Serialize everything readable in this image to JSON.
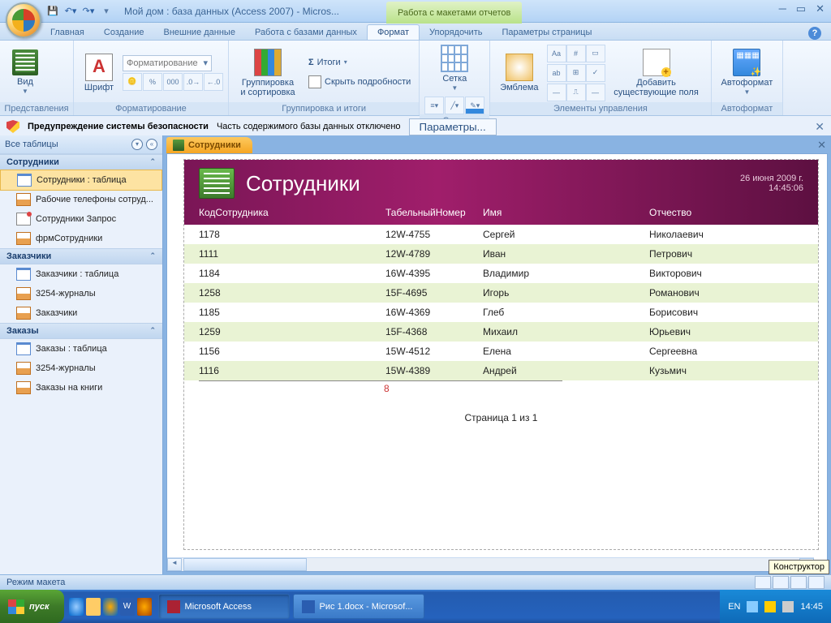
{
  "title": "Мой дом : база данных (Access 2007) - Micros...",
  "context_tab": "Работа с макетами отчетов",
  "ribbon_tabs": [
    "Главная",
    "Создание",
    "Внешние данные",
    "Работа с базами данных",
    "Формат",
    "Упорядочить",
    "Параметры страницы"
  ],
  "active_tab_index": 4,
  "ribbon": {
    "view": "Вид",
    "view_group": "Представления",
    "font": "Шрифт",
    "formatting_combo": "Форматирование",
    "formatting_group": "Форматирование",
    "grouping": "Группировка и сортировка",
    "totals": "Итоги",
    "hide_details": "Скрыть подробности",
    "grouping_group": "Группировка и итоги",
    "grid": "Сетка",
    "grid_group": "Сетка",
    "emblem": "Эмблема",
    "add_fields": "Добавить существующие поля",
    "controls_group": "Элементы управления",
    "autoformat": "Автоформат",
    "autoformat_group": "Автоформат"
  },
  "security": {
    "heading": "Предупреждение системы безопасности",
    "msg": "Часть содержимого базы данных отключено",
    "btn": "Параметры..."
  },
  "nav": {
    "header": "Все таблицы",
    "groups": [
      {
        "title": "Сотрудники",
        "items": [
          {
            "icon": "tbl",
            "label": "Сотрудники : таблица",
            "sel": true
          },
          {
            "icon": "frm",
            "label": "Рабочие телефоны сотруд..."
          },
          {
            "icon": "qry",
            "label": "Сотрудники Запрос"
          },
          {
            "icon": "frm",
            "label": "фрмСотрудники"
          }
        ]
      },
      {
        "title": "Заказчики",
        "items": [
          {
            "icon": "tbl",
            "label": "Заказчики : таблица"
          },
          {
            "icon": "frm",
            "label": "3254-журналы"
          },
          {
            "icon": "frm",
            "label": "Заказчики"
          }
        ]
      },
      {
        "title": "Заказы",
        "items": [
          {
            "icon": "tbl",
            "label": "Заказы : таблица"
          },
          {
            "icon": "frm",
            "label": "3254-журналы"
          },
          {
            "icon": "frm",
            "label": "Заказы на книги"
          }
        ]
      }
    ]
  },
  "doc_tab": "Сотрудники",
  "report": {
    "title": "Сотрудники",
    "date": "26 июня 2009 г.",
    "time": "14:45:06",
    "columns": [
      "КодСотрудника",
      "ТабельныйНомер",
      "Имя",
      "Отчество"
    ],
    "rows": [
      [
        "1178",
        "12W-4755",
        "Сергей",
        "Николаевич"
      ],
      [
        "1111",
        "12W-4789",
        "Иван",
        "Петрович"
      ],
      [
        "1184",
        "16W-4395",
        "Владимир",
        "Викторович"
      ],
      [
        "1258",
        "15F-4695",
        "Игорь",
        "Романович"
      ],
      [
        "1185",
        "16W-4369",
        "Глеб",
        "Борисович"
      ],
      [
        "1259",
        "15F-4368",
        "Михаил",
        "Юрьевич"
      ],
      [
        "1156",
        "15W-4512",
        "Елена",
        "Сергеевна"
      ],
      [
        "1116",
        "15W-4389",
        "Андрей",
        "Кузьмич"
      ]
    ],
    "count": "8",
    "page": "Страница 1 из 1"
  },
  "status": "Режим макета",
  "tooltip": "Конструктор",
  "taskbar": {
    "start": "пуск",
    "apps": [
      {
        "label": "Microsoft Access",
        "active": true,
        "color": "#a23"
      },
      {
        "label": "Рис 1.docx - Microsof...",
        "active": false,
        "color": "#2a5db0"
      }
    ],
    "lang": "EN",
    "clock": "14:45"
  }
}
